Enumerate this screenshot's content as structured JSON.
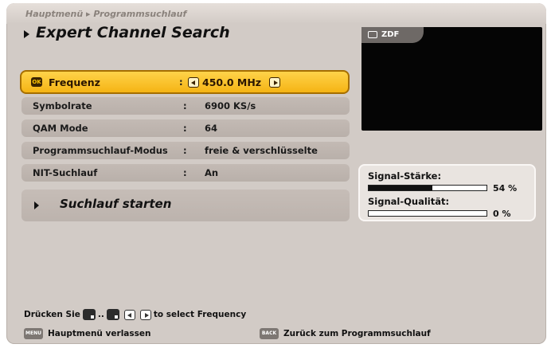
{
  "header": {
    "breadcrumb": "Hauptmenü ▸ Programmsuchlauf",
    "title": "Expert Channel Search"
  },
  "settings": {
    "rows": [
      {
        "label": "Frequenz",
        "value": "450.0 MHz",
        "active": true
      },
      {
        "label": "Symbolrate",
        "value": "6900 KS/s"
      },
      {
        "label": "QAM Mode",
        "value": "64"
      },
      {
        "label": "Programmsuchlauf-Modus",
        "value": "freie & verschlüsselte"
      },
      {
        "label": "NIT-Suchlauf",
        "value": "An"
      }
    ],
    "colon": ":",
    "start_label": "Suchlauf starten"
  },
  "preview": {
    "channel": "ZDF"
  },
  "signal": {
    "strength_label": "Signal-Stärke:",
    "strength_value": "54 %",
    "strength_level": 0.54,
    "quality_label": "Signal-Qualität:",
    "quality_value": "0 %",
    "quality_level": 0.0
  },
  "hint": {
    "prefix": "Drücken Sie",
    "ellipsis": "..",
    "suffix": "to select Frequency"
  },
  "footer": {
    "menu_key": "MENU",
    "menu_label": "Hauptmenü verlassen",
    "back_key": "BACK",
    "back_label": "Zurück zum Programmsuchlauf"
  },
  "colors": {
    "active_row": "#f5b414",
    "panel_bg": "#d2cbc6",
    "row_bg": "#bcb3ad"
  }
}
